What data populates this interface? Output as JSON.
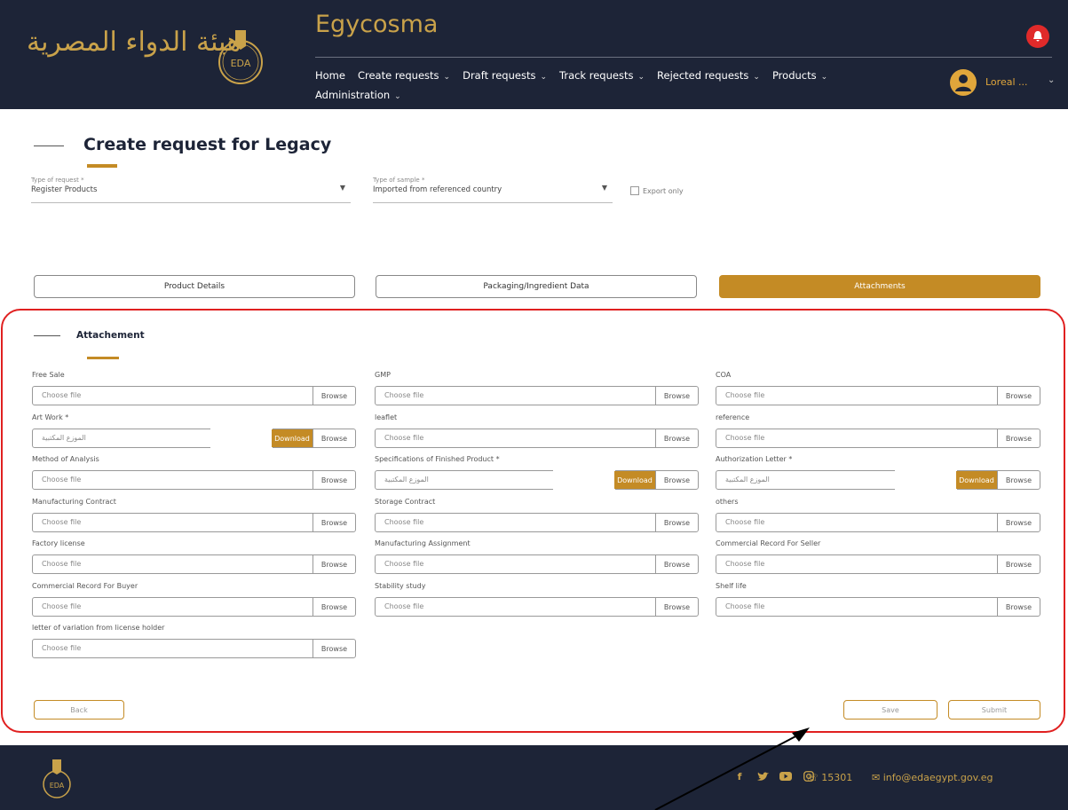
{
  "header": {
    "brand_arabic": "هيئة الدواء المصرية",
    "app_title": "Egycosma",
    "nav": [
      {
        "label": "Home",
        "has_dropdown": false
      },
      {
        "label": "Create requests",
        "has_dropdown": true
      },
      {
        "label": "Draft requests",
        "has_dropdown": true
      },
      {
        "label": "Track requests",
        "has_dropdown": true
      },
      {
        "label": "Rejected requests",
        "has_dropdown": true
      },
      {
        "label": "Products",
        "has_dropdown": true
      },
      {
        "label": "Administration",
        "has_dropdown": true
      }
    ],
    "user_name": "Loreal ...",
    "chevron": "⌄",
    "emblem_text": "EDA"
  },
  "page": {
    "title": "Create request for Legacy",
    "type_of_request": {
      "label": "Type of request *",
      "value": "Register Products"
    },
    "type_of_sample": {
      "label": "Type of sample *",
      "value": "Imported from referenced country"
    },
    "export_only": "Export only"
  },
  "tabs": [
    {
      "label": "Product Details",
      "active": false
    },
    {
      "label": "Packaging/Ingredient Data",
      "active": false
    },
    {
      "label": "Attachments",
      "active": true
    }
  ],
  "attachment_section": {
    "title": "Attachement",
    "choose_placeholder": "Choose file",
    "uploaded_text": "الموزع المكتبية",
    "browse_label": "Browse",
    "download_label": "Download",
    "columns": [
      [
        {
          "label": "Free Sale",
          "uploaded": false
        },
        {
          "label": "Art Work *",
          "uploaded": true
        },
        {
          "label": "Method of Analysis",
          "uploaded": false
        },
        {
          "label": "Manufacturing Contract",
          "uploaded": false
        },
        {
          "label": "Factory license",
          "uploaded": false
        },
        {
          "label": "Commercial Record For Buyer",
          "uploaded": false
        },
        {
          "label": "letter of variation from license holder",
          "uploaded": false
        }
      ],
      [
        {
          "label": "GMP",
          "uploaded": false
        },
        {
          "label": "leaflet",
          "uploaded": false
        },
        {
          "label": "Specifications of Finished Product *",
          "uploaded": true
        },
        {
          "label": "Storage Contract",
          "uploaded": false
        },
        {
          "label": "Manufacturing Assignment",
          "uploaded": false
        },
        {
          "label": "Stability study",
          "uploaded": false
        }
      ],
      [
        {
          "label": "COA",
          "uploaded": false
        },
        {
          "label": "reference",
          "uploaded": false
        },
        {
          "label": "Authorization Letter *",
          "uploaded": true
        },
        {
          "label": "others",
          "uploaded": false
        },
        {
          "label": "Commercial Record For Seller",
          "uploaded": false
        },
        {
          "label": "Shelf life",
          "uploaded": false
        }
      ]
    ]
  },
  "actions": {
    "back": "Back",
    "save": "Save",
    "submit": "Submit"
  },
  "footer": {
    "social_icons": [
      "facebook-icon",
      "twitter-icon",
      "youtube-icon",
      "instagram-icon"
    ],
    "phone": "15301",
    "email": "info@edaegypt.gov.eg"
  },
  "colors": {
    "navy": "#1d2437",
    "gold": "#c48b25",
    "highlight_red": "#e02020"
  }
}
